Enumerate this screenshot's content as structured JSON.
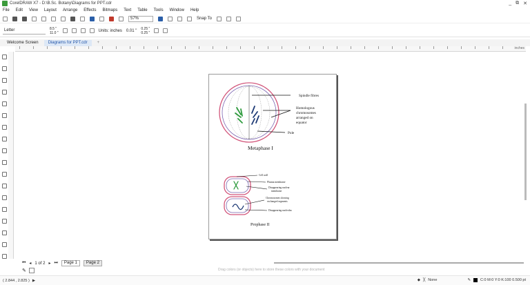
{
  "window": {
    "title": "CorelDRAW X7 - D:\\B.Sc. Botany\\Diagrams for PPT.cdr",
    "controls": [
      "_",
      "⧉",
      "✕"
    ]
  },
  "menu": [
    "File",
    "Edit",
    "View",
    "Layout",
    "Arrange",
    "Effects",
    "Bitmaps",
    "Text",
    "Table",
    "Tools",
    "Window",
    "Help"
  ],
  "toolbar": {
    "zoom": "57%",
    "snap_to": "Snap To"
  },
  "property_bar": {
    "paper": "Letter",
    "width": "8.5 \"",
    "height": "11.0 \"",
    "units": "Units: inches",
    "nudge": "0.01 \"",
    "dup_x": "0.25 \"",
    "dup_y": "0.25 \""
  },
  "tabs": [
    "Welcome Screen",
    "Diagrams for PPT.cdr",
    "+"
  ],
  "ruler_units": "inches",
  "diagram": {
    "metaphase_labels": [
      "Spindle fibres",
      "Homologous",
      "chromosomes",
      "arranged on",
      "equator",
      "Pole"
    ],
    "metaphase_title": "Metaphase I",
    "prophase_labels": [
      "Cell wall",
      "Plasma membrane",
      "Disappearing nuclear",
      "membrane",
      "Chromosomes showing",
      "exchanged segments",
      "Disappearing nucleolus"
    ],
    "prophase_title": "Prophase II"
  },
  "page_nav": {
    "count": "1 of 2",
    "page1": "Page 1",
    "page2": "Page 2"
  },
  "palette_hint": "Drag colors (or objects) here to store these colors with your document",
  "status": {
    "coords": "( 2.844 , 2.825 )",
    "fill": "None",
    "outline": "C:0 M:0 Y:0 K:100  0.500 pt"
  }
}
